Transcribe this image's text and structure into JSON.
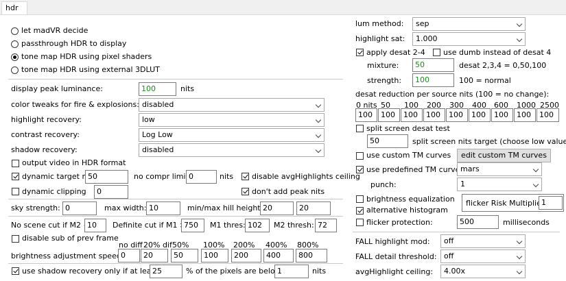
{
  "tab": {
    "label": "hdr"
  },
  "modes": [
    {
      "label": "let madVR decide",
      "selected": false
    },
    {
      "label": "passthrough HDR to display",
      "selected": false
    },
    {
      "label": "tone map HDR using pixel shaders",
      "selected": true
    },
    {
      "label": "tone map HDR using external 3DLUT",
      "selected": false
    }
  ],
  "display_peak": {
    "label": "display peak luminance:",
    "value": "100",
    "unit": "nits"
  },
  "color_tweaks": {
    "label": "color tweaks for fire & explosions:",
    "value": "disabled"
  },
  "highlight_recovery": {
    "label": "highlight recovery:",
    "value": "low"
  },
  "contrast_recovery": {
    "label": "contrast recovery:",
    "value": "Log Low"
  },
  "shadow_recovery": {
    "label": "shadow recovery:",
    "value": "disabled"
  },
  "output_hdr": {
    "label": "output video in HDR format",
    "checked": false
  },
  "dynamic_target": {
    "label": "dynamic target nits",
    "checked": true,
    "value": "50"
  },
  "no_compr": {
    "label": "no compr limit:",
    "value": "0",
    "unit": "nits"
  },
  "disable_avg": {
    "label": "disable avgHighlights ceiling",
    "checked": true
  },
  "dynamic_clipping": {
    "label": "dynamic clipping",
    "checked": false,
    "value": "0"
  },
  "dont_add_peak": {
    "label": "don't add peak nits",
    "checked": true
  },
  "sky": {
    "label": "sky strength:",
    "value": "0",
    "max_width_label": "max width:",
    "max_width": "10",
    "hill_label": "min/max hill height:",
    "hill_min": "20",
    "hill_max": "20"
  },
  "scene_cut": {
    "no_cut_label": "No scene cut if M2 <",
    "no_cut": "10",
    "def_cut_label": "Definite cut if M1 >",
    "def_cut": "750",
    "m1_label": "M1 thres:",
    "m1": "102",
    "m2_label": "M2 thresh:",
    "m2": "72"
  },
  "disable_sub_prev": {
    "label": "disable sub of prev frame",
    "checked": false
  },
  "speeds": {
    "label": "brightness adjustment speeds:",
    "headers": [
      "no diff",
      "20% dif",
      "50%",
      "100%",
      "200%",
      "400%",
      "800%"
    ],
    "values": [
      "0",
      "20",
      "50",
      "100",
      "200",
      "400",
      "800"
    ]
  },
  "shadow_only": {
    "label": "use shadow recovery only if at least:",
    "checked": true,
    "percent": "25",
    "mid": "% of the pixels are below",
    "nits": "1",
    "unit": "nits"
  },
  "lum_method": {
    "label": "lum method:",
    "value": "sep"
  },
  "highlight_sat": {
    "label": "highlight sat:",
    "value": "1.000"
  },
  "apply_desat": {
    "label": "apply desat 2-4",
    "checked": true
  },
  "use_dumb": {
    "label": "use dumb instead of desat 4",
    "checked": false
  },
  "mixture": {
    "label": "mixture:",
    "value": "50",
    "note": "desat 2,3,4 = 0,50,100"
  },
  "strength": {
    "label": "strength:",
    "value": "100",
    "note": "100 = normal"
  },
  "desat_reduction": {
    "label": "desat reduction per source nits (100 = no change):",
    "headers": [
      "0 nits",
      "50",
      "100",
      "200",
      "300",
      "400",
      "600",
      "1000",
      "2500"
    ],
    "values": [
      "100",
      "100",
      "100",
      "100",
      "100",
      "100",
      "100",
      "100",
      "100"
    ]
  },
  "split_screen": {
    "label": "split screen desat test",
    "checked": false,
    "value": "50",
    "note": "split screen nits target (choose low value)"
  },
  "custom_tm": {
    "label": "use custom TM curves",
    "checked": false,
    "button": "edit custom TM curves"
  },
  "predefined_tm": {
    "label": "use predefined TM curve",
    "checked": true,
    "value": "mars"
  },
  "punch": {
    "label": "punch:",
    "value": "1"
  },
  "brightness_eq": {
    "label": "brightness equalization",
    "checked": false
  },
  "flicker_risk": {
    "label": "flicker Risk Multiplier:",
    "value": "1"
  },
  "alt_histogram": {
    "label": "alternative histogram",
    "checked": true
  },
  "flicker_protection": {
    "label": "flicker protection:",
    "checked": false,
    "value": "500",
    "unit": "milliseconds"
  },
  "fall_highlight": {
    "label": "FALL highlight mod:",
    "value": "off"
  },
  "fall_detail": {
    "label": "FALL detail threshold:",
    "value": "off"
  },
  "avg_ceiling": {
    "label": "avgHighlight ceiling:",
    "value": "4.00x"
  }
}
